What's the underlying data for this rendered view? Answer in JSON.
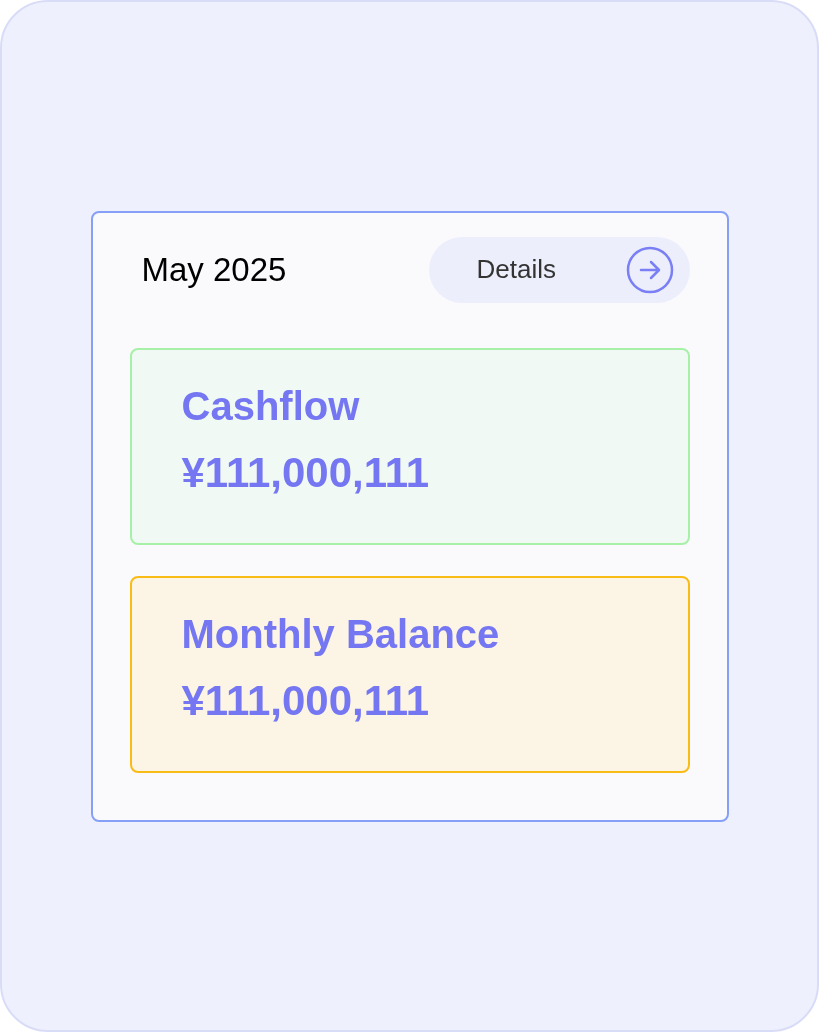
{
  "header": {
    "title": "May 2025",
    "details_button": {
      "label": "Details"
    }
  },
  "cards": [
    {
      "label": "Cashflow",
      "value": "¥111,000,111",
      "color": "#a6f0a8"
    },
    {
      "label": "Monthly Balance",
      "value": "¥111,000,111",
      "color": "#f9bc16"
    }
  ]
}
